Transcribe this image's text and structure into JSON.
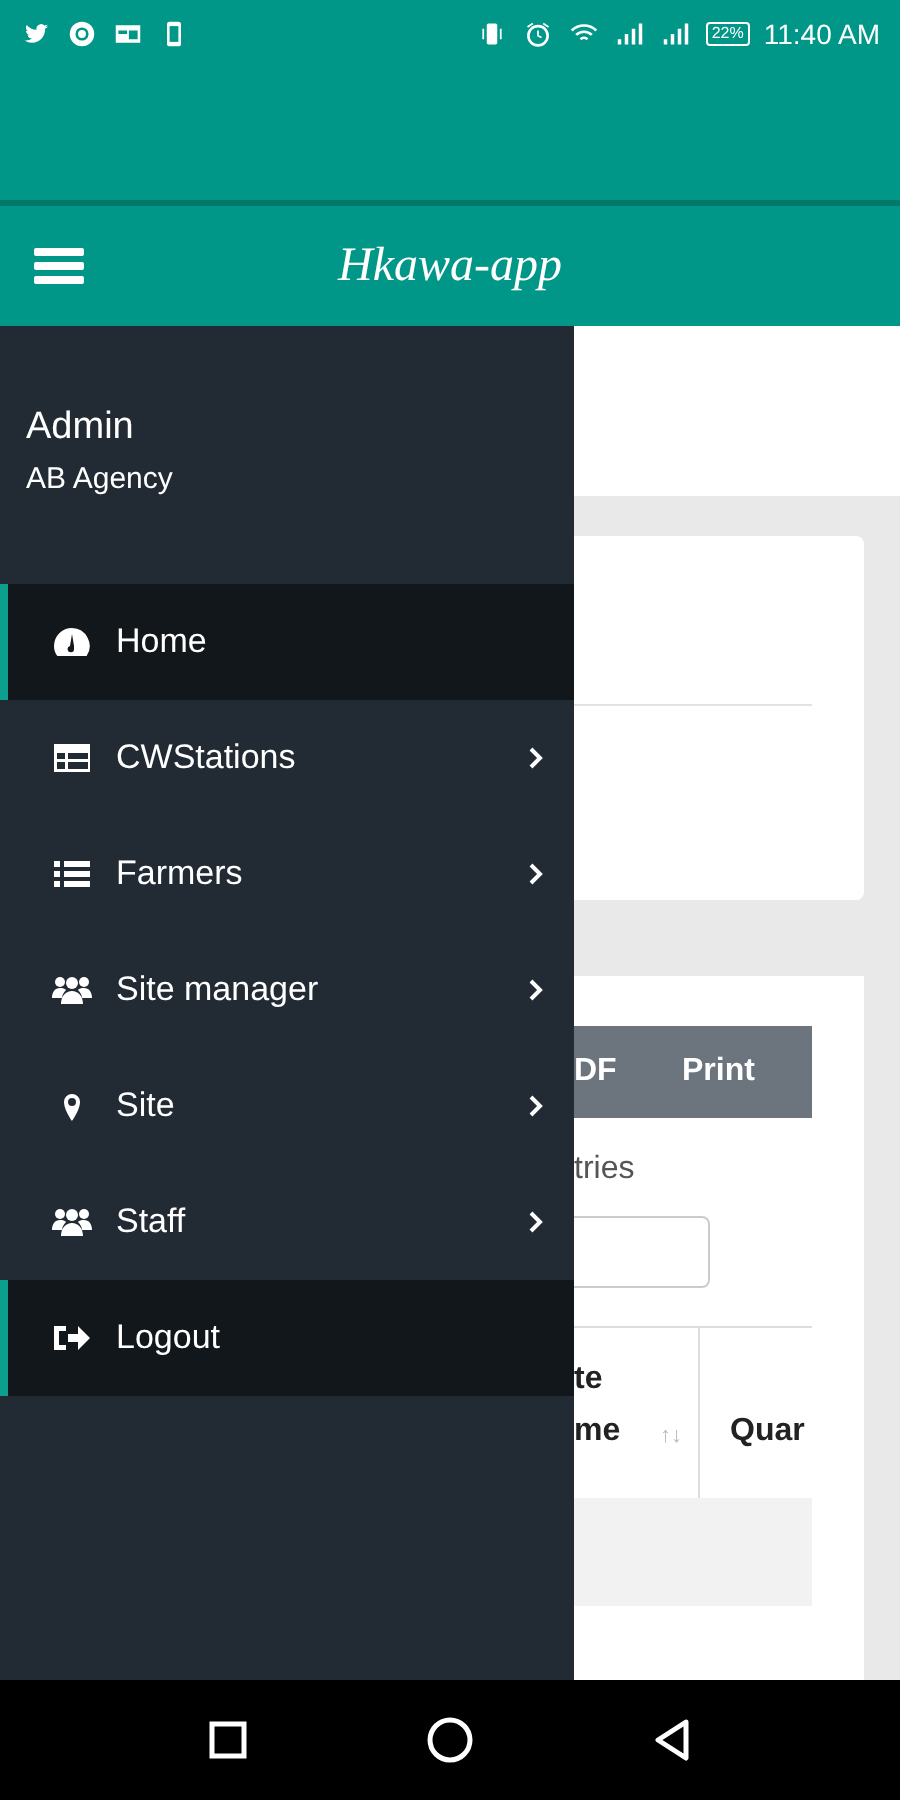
{
  "status_bar": {
    "time": "11:40 AM",
    "battery": "22%"
  },
  "app_bar": {
    "title": "Hkawa-app"
  },
  "drawer": {
    "user_name": "Admin",
    "organization": "AB Agency",
    "items": [
      {
        "label": "Home",
        "kind": "dashboard",
        "highlighted": true,
        "has_submenu": false
      },
      {
        "label": "CWStations",
        "kind": "table",
        "highlighted": false,
        "has_submenu": true
      },
      {
        "label": "Farmers",
        "kind": "list",
        "highlighted": false,
        "has_submenu": true
      },
      {
        "label": "Site manager",
        "kind": "people",
        "highlighted": false,
        "has_submenu": true
      },
      {
        "label": "Site",
        "kind": "place",
        "highlighted": false,
        "has_submenu": true
      },
      {
        "label": "Staff",
        "kind": "people",
        "highlighted": false,
        "has_submenu": true
      },
      {
        "label": "Logout",
        "kind": "exit",
        "highlighted": true,
        "has_submenu": false
      }
    ]
  },
  "content": {
    "export_buttons": [
      "DF",
      "Print"
    ],
    "entries_label": "tries",
    "table": {
      "columns": [
        {
          "label_lines": [
            "te",
            "me"
          ],
          "sort_mark": "↑↓"
        },
        {
          "label_lines": [
            "Quar"
          ]
        }
      ]
    }
  }
}
